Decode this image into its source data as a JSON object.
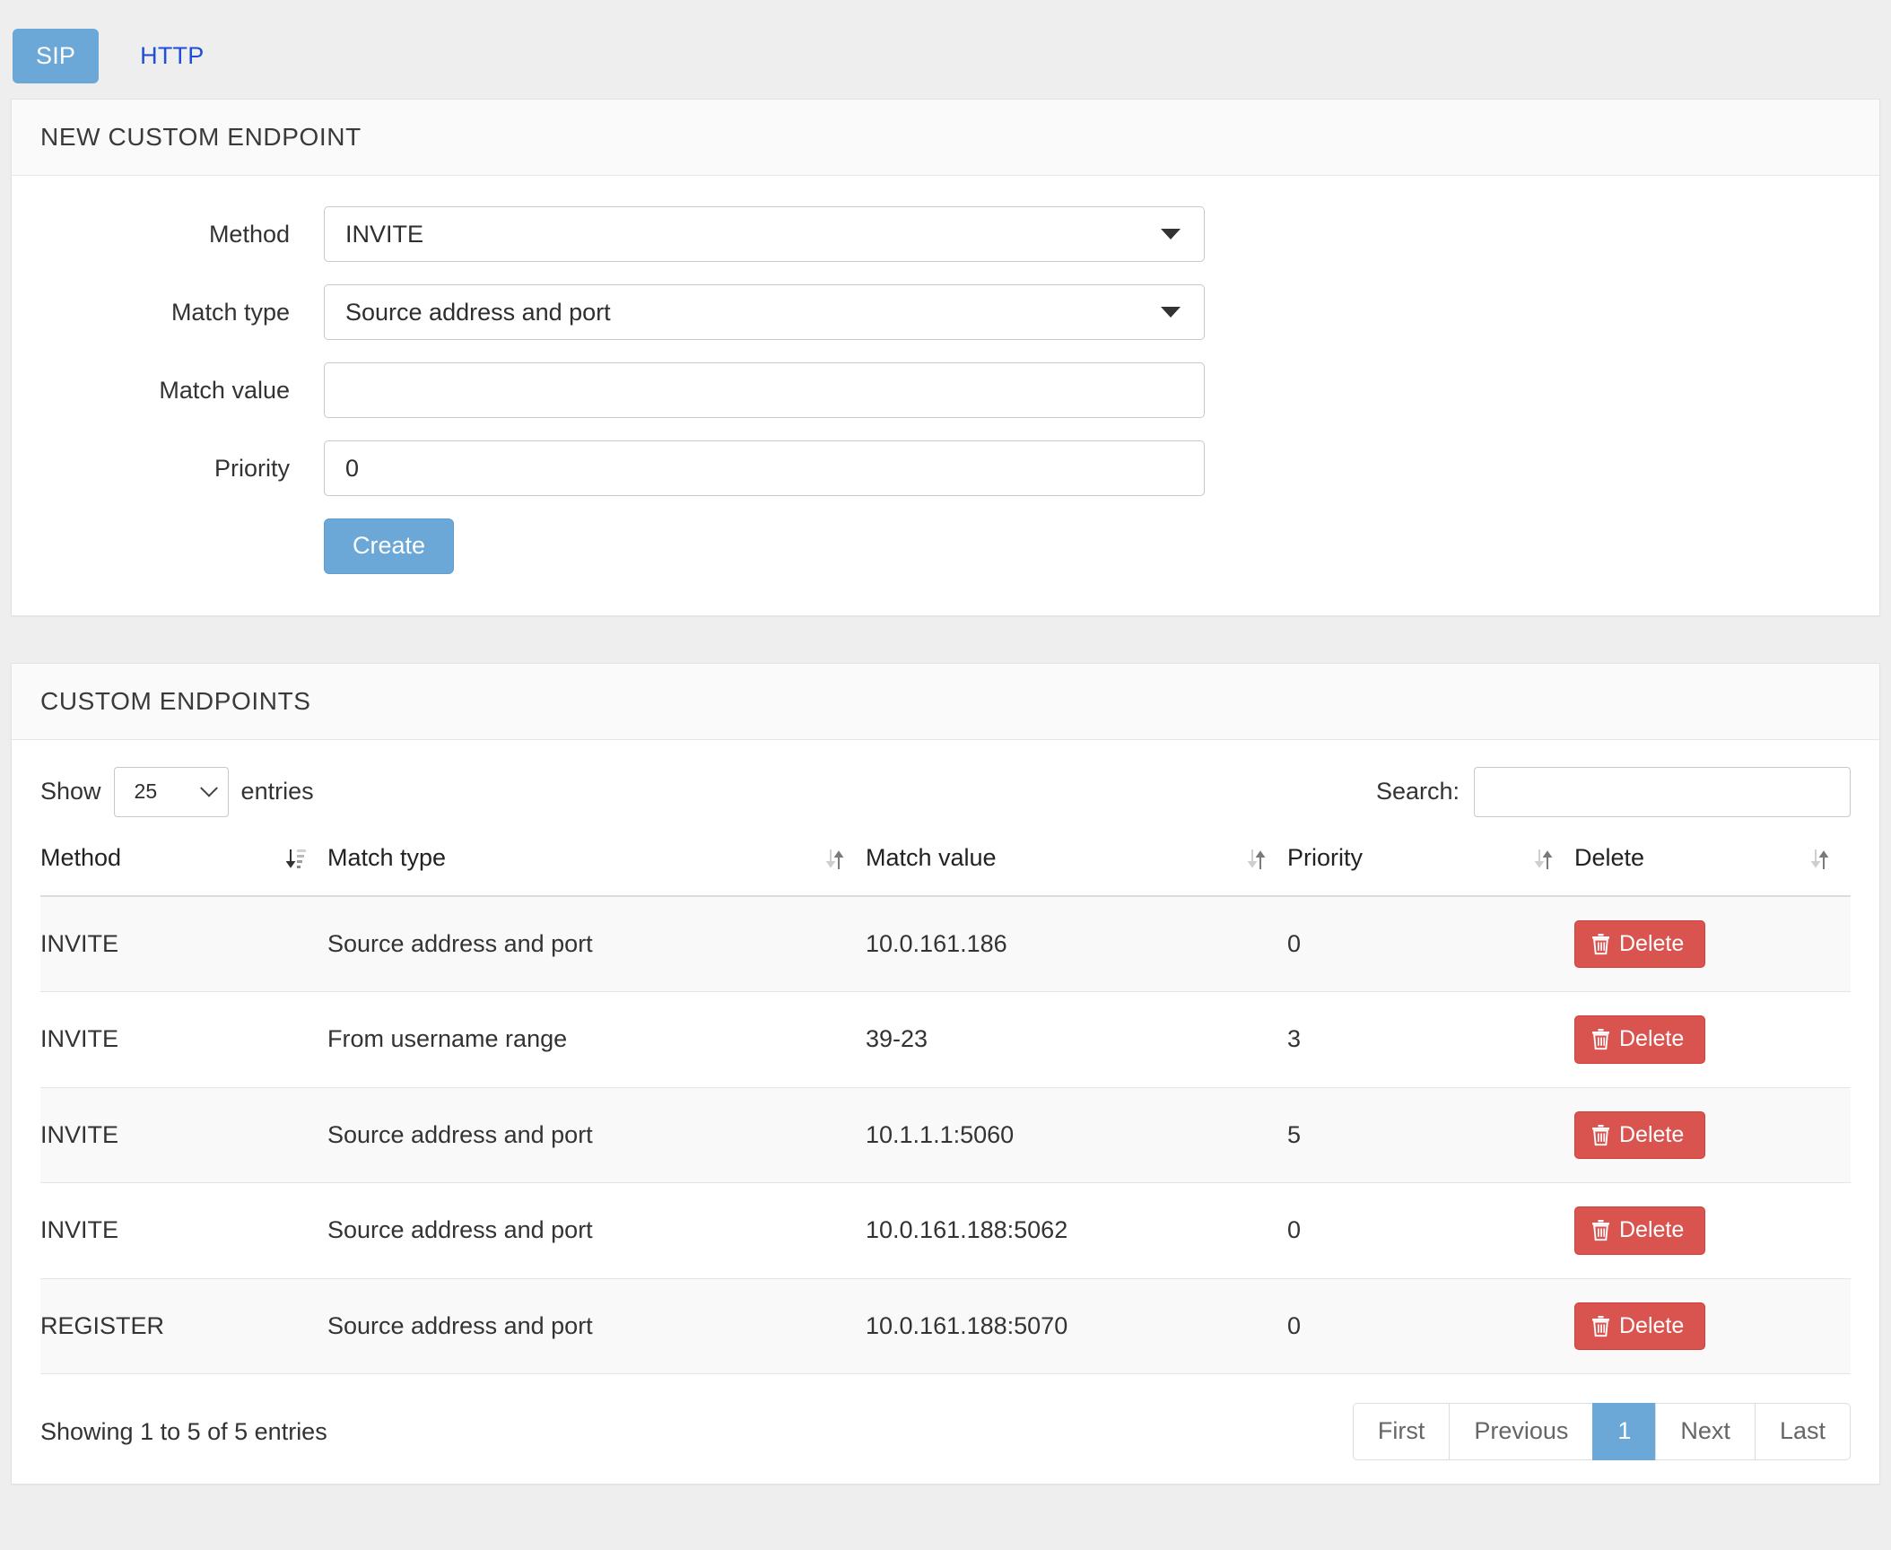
{
  "tabs": [
    {
      "label": "SIP",
      "active": true
    },
    {
      "label": "HTTP",
      "active": false
    }
  ],
  "new_endpoint": {
    "panel_title": "NEW CUSTOM ENDPOINT",
    "fields": {
      "method_label": "Method",
      "method_value": "INVITE",
      "match_type_label": "Match type",
      "match_type_value": "Source address and port",
      "match_value_label": "Match value",
      "match_value_value": "",
      "match_value_placeholder": "",
      "priority_label": "Priority",
      "priority_value": "0"
    },
    "create_button": "Create"
  },
  "endpoints_panel": {
    "panel_title": "CUSTOM ENDPOINTS",
    "toolbar": {
      "show_label": "Show",
      "entries_label": "entries",
      "page_length": "25",
      "search_label": "Search:",
      "search_value": "",
      "search_placeholder": ""
    },
    "columns": [
      {
        "label": "Method",
        "sort": "active-desc"
      },
      {
        "label": "Match type",
        "sort": "none"
      },
      {
        "label": "Match value",
        "sort": "none"
      },
      {
        "label": "Priority",
        "sort": "none"
      },
      {
        "label": "Delete",
        "sort": "none"
      }
    ],
    "rows": [
      {
        "method": "INVITE",
        "match_type": "Source address and port",
        "match_value": "10.0.161.186",
        "priority": "0",
        "delete_label": "Delete"
      },
      {
        "method": "INVITE",
        "match_type": "From username range",
        "match_value": "39-23",
        "priority": "3",
        "delete_label": "Delete"
      },
      {
        "method": "INVITE",
        "match_type": "Source address and port",
        "match_value": "10.1.1.1:5060",
        "priority": "5",
        "delete_label": "Delete"
      },
      {
        "method": "INVITE",
        "match_type": "Source address and port",
        "match_value": "10.0.161.188:5062",
        "priority": "0",
        "delete_label": "Delete"
      },
      {
        "method": "REGISTER",
        "match_type": "Source address and port",
        "match_value": "10.0.161.188:5070",
        "priority": "0",
        "delete_label": "Delete"
      }
    ],
    "info": "Showing 1 to 5 of 5 entries",
    "pagination": [
      {
        "label": "First",
        "active": false
      },
      {
        "label": "Previous",
        "active": false
      },
      {
        "label": "1",
        "active": true
      },
      {
        "label": "Next",
        "active": false
      },
      {
        "label": "Last",
        "active": false
      }
    ]
  },
  "colors": {
    "accent": "#6ba8d8",
    "link": "#1f4fd8",
    "danger": "#d9534f",
    "page_bg": "#eeeeee",
    "panel_bg": "#ffffff",
    "panel_heading_bg": "#fafafa",
    "row_stripe": "#f9f9f9"
  },
  "icons": {
    "caret_down": "caret-down-icon",
    "chevron_down": "chevron-down-icon",
    "sort_active": "sort-amount-down-icon",
    "sort_inactive": "sort-icon",
    "trash": "trash-icon"
  }
}
